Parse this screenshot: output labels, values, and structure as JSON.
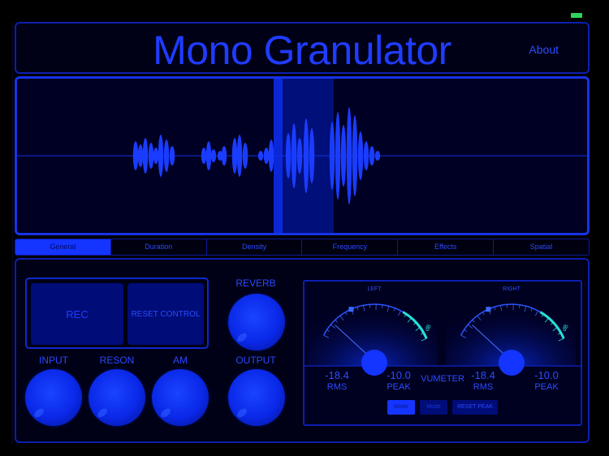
{
  "app": {
    "title": "Mono Granulator",
    "about": "About"
  },
  "colors": {
    "accent": "#1434ff",
    "panel_border": "#0d1fb0",
    "status_green": "#2fd45a",
    "vu_cyan": "#29e0d8"
  },
  "tabs": [
    {
      "label": "General",
      "active": true
    },
    {
      "label": "Duration",
      "active": false
    },
    {
      "label": "Density",
      "active": false
    },
    {
      "label": "Frequency",
      "active": false
    },
    {
      "label": "Effects",
      "active": false
    },
    {
      "label": "Spatial",
      "active": false
    }
  ],
  "recorder": {
    "rec_label": "REC",
    "reset_control_label": "RESET CONTROL"
  },
  "knobs": {
    "reverb": "REVERB",
    "input": "INPUT",
    "reson": "RESON",
    "am": "AM",
    "output": "OUTPUT"
  },
  "vumeter": {
    "label": "VUMETER",
    "left": {
      "channel": "LEFT",
      "rms_value": "-18.4",
      "rms_label": "RMS",
      "peak_value": "-10.0",
      "peak_label": "PEAK"
    },
    "right": {
      "channel": "RIGHT",
      "rms_value": "-18.4",
      "rms_label": "RMS",
      "peak_value": "-10.0",
      "peak_label": "PEAK"
    },
    "scale_unit": "dB",
    "mode_buttons": [
      "Mode",
      "Mode"
    ],
    "reset_peak_label": "RESET PEAK"
  }
}
